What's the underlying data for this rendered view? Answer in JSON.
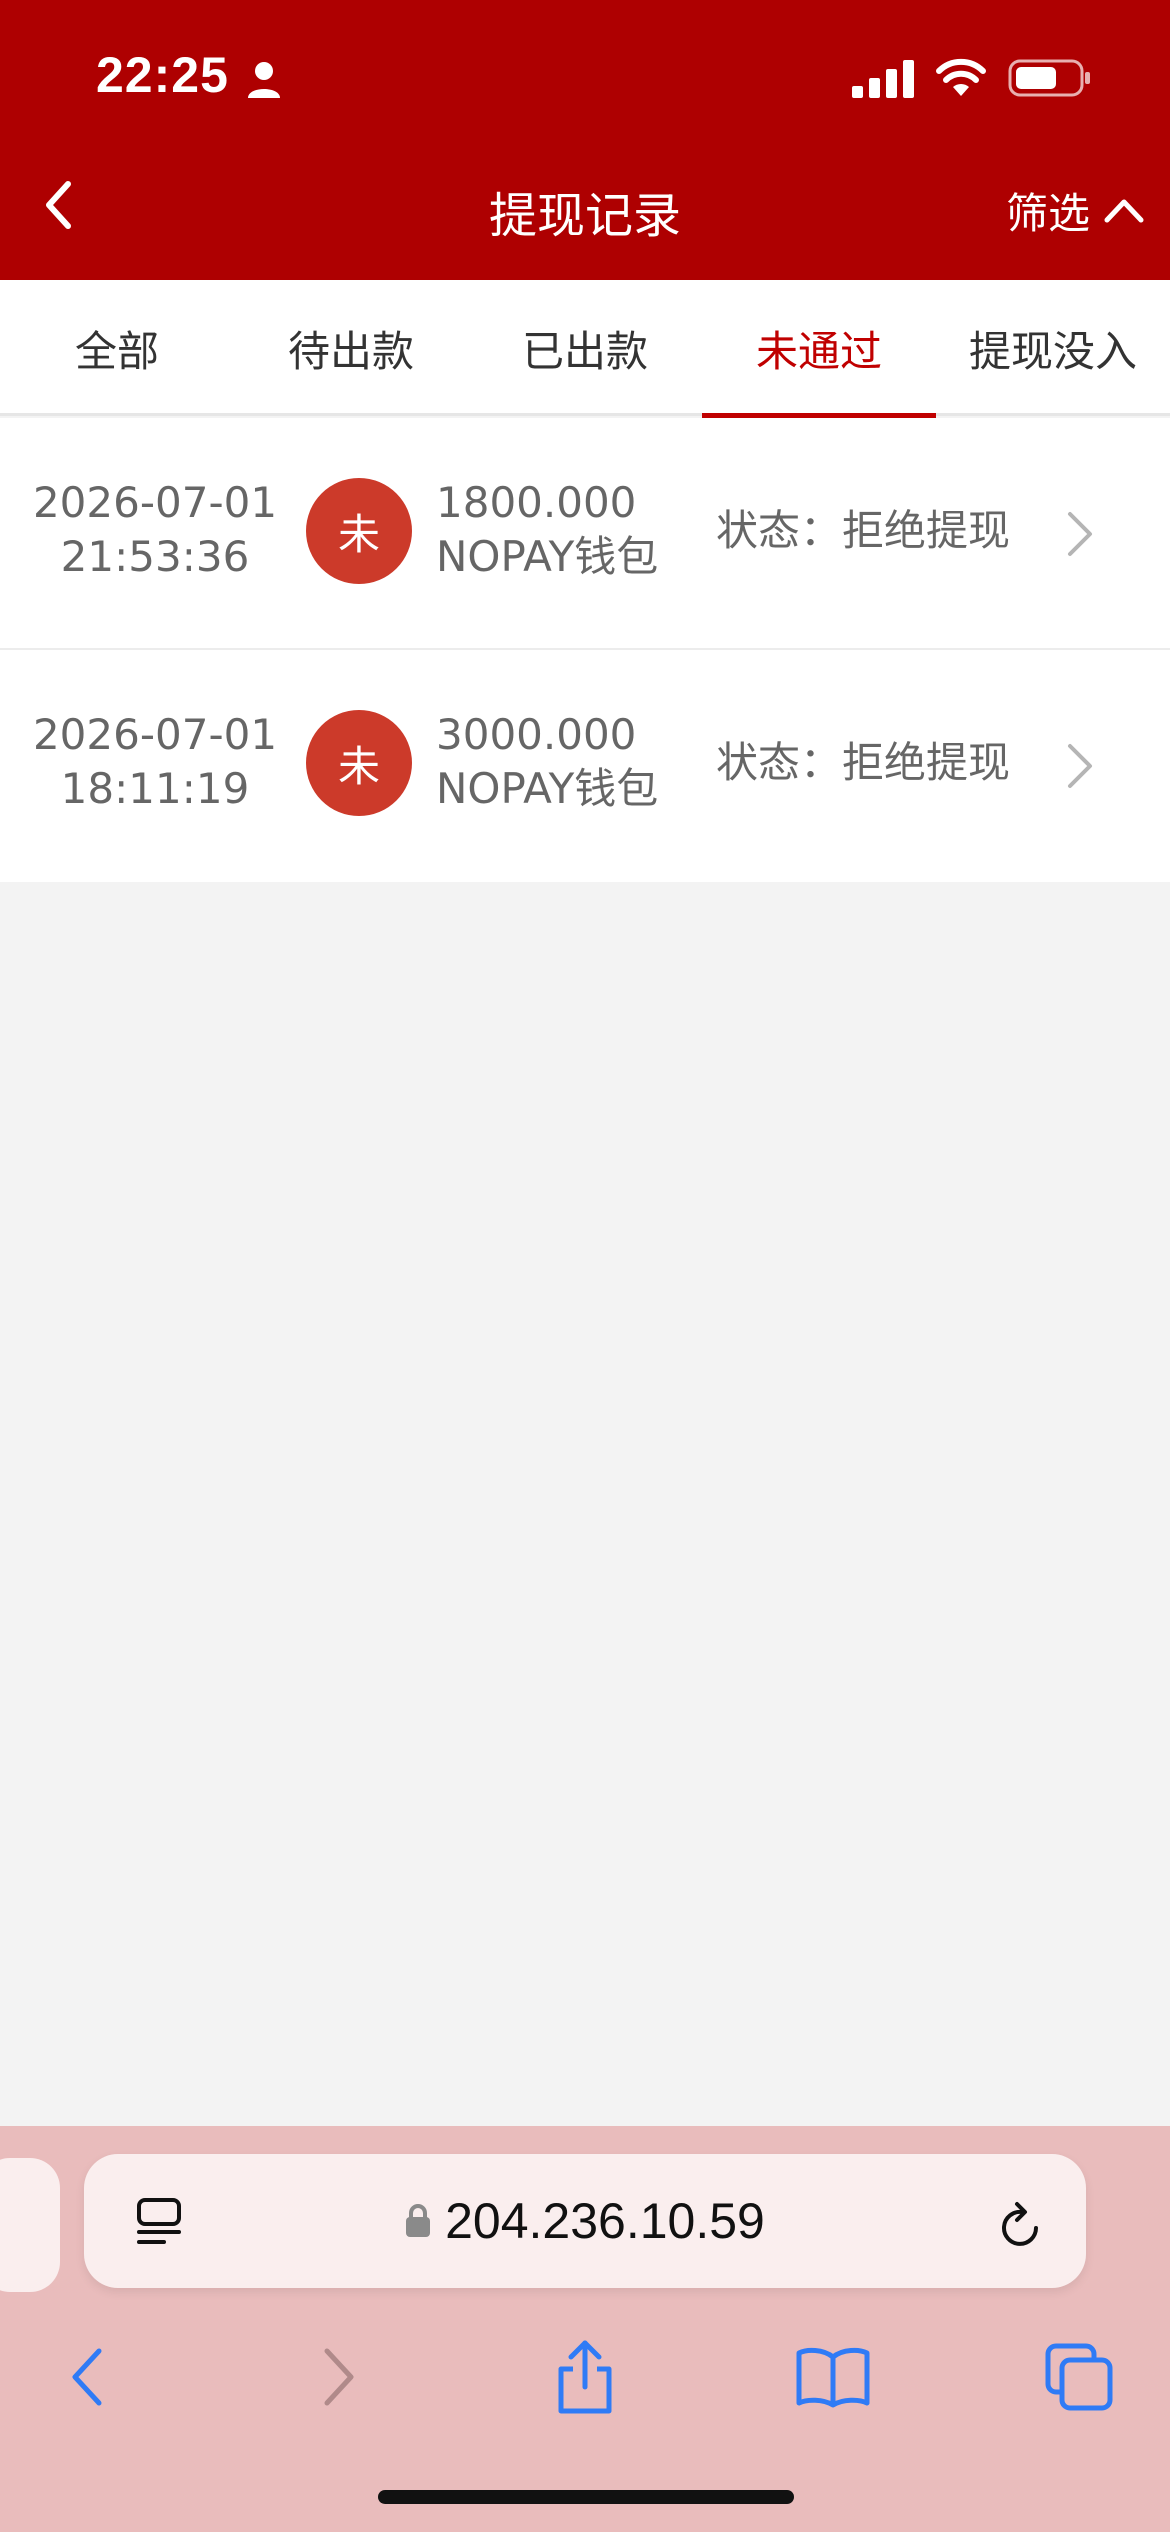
{
  "status_bar": {
    "time": "22:25"
  },
  "nav": {
    "title": "提现记录",
    "filter_label": "筛选"
  },
  "tabs": [
    {
      "label": "全部",
      "active": false
    },
    {
      "label": "待出款",
      "active": false
    },
    {
      "label": "已出款",
      "active": false
    },
    {
      "label": "未通过",
      "active": true
    },
    {
      "label": "提现没入",
      "active": false
    }
  ],
  "records": [
    {
      "date": "2026-07-01",
      "time": "21:53:36",
      "badge": "未",
      "amount": "1800.000",
      "wallet": "NOPAY钱包",
      "status": "状态：拒绝提现"
    },
    {
      "date": "2026-07-01",
      "time": "18:11:19",
      "badge": "未",
      "amount": "3000.000",
      "wallet": "NOPAY钱包",
      "status": "状态：拒绝提现"
    }
  ],
  "browser": {
    "url": "204.236.10.59"
  },
  "colors": {
    "header_bg": "#ae0001",
    "active_tab": "#c00000",
    "badge_bg": "#cc3a2a",
    "browser_bar_bg": "#e9bcbc",
    "ios_blue": "#2f7bf6"
  }
}
